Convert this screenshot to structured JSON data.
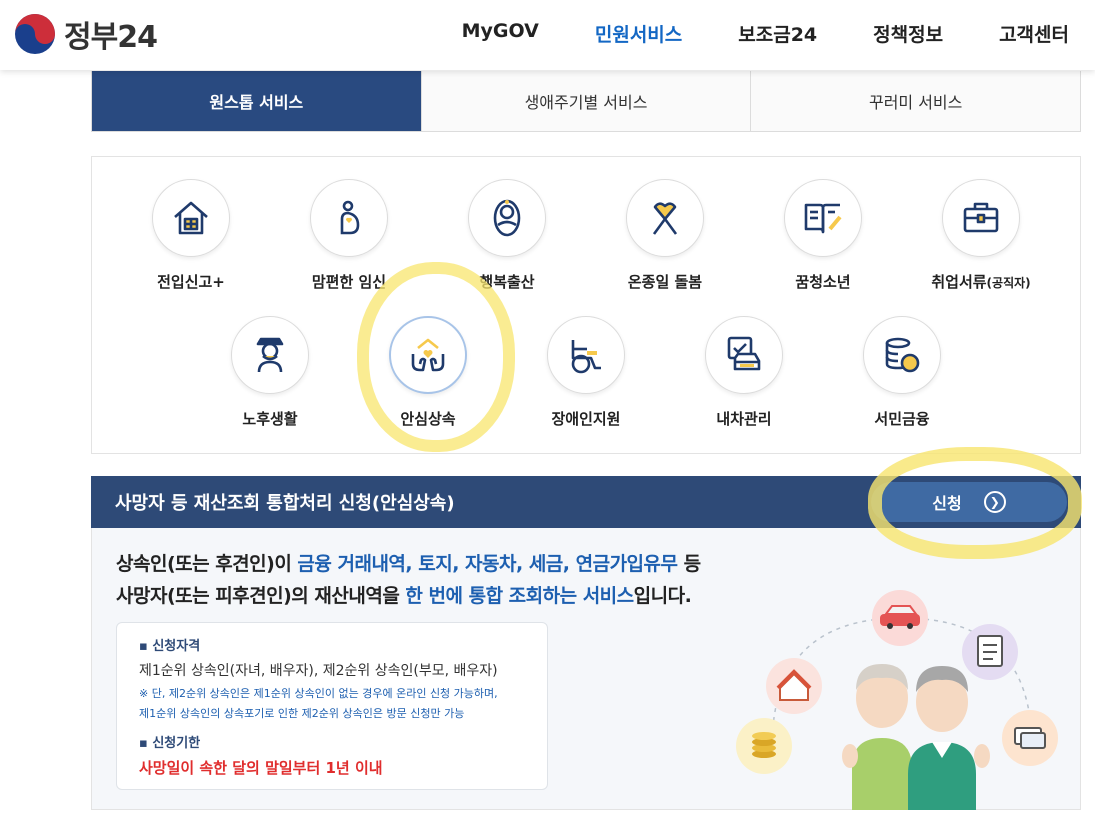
{
  "header": {
    "logo_text": "정부24",
    "nav": [
      {
        "label": "MyGOV",
        "active": false
      },
      {
        "label": "민원서비스",
        "active": true
      },
      {
        "label": "보조금24",
        "active": false
      },
      {
        "label": "정책정보",
        "active": false
      },
      {
        "label": "고객센터",
        "active": false
      }
    ]
  },
  "tabs": [
    {
      "label": "원스톱 서비스",
      "active": true
    },
    {
      "label": "생애주기별 서비스",
      "active": false
    },
    {
      "label": "꾸러미 서비스",
      "active": false
    }
  ],
  "services_row1": [
    {
      "label": "전입신고+",
      "icon": "house-icon"
    },
    {
      "label": "맘편한 임신",
      "icon": "pregnancy-icon"
    },
    {
      "label": "행복출산",
      "icon": "baby-icon"
    },
    {
      "label": "온종일 돌봄",
      "icon": "ribbon-heart-icon"
    },
    {
      "label": "꿈청소년",
      "icon": "open-book-icon"
    },
    {
      "label": "취업서류",
      "label_small": "(공직자)",
      "icon": "briefcase-icon"
    }
  ],
  "services_row2": [
    {
      "label": "노후생활",
      "icon": "elderly-icon"
    },
    {
      "label": "안심상속",
      "icon": "hands-house-heart-icon",
      "selected": true
    },
    {
      "label": "장애인지원",
      "icon": "wheelchair-icon"
    },
    {
      "label": "내차관리",
      "icon": "car-check-icon"
    },
    {
      "label": "서민금융",
      "icon": "coins-icon"
    }
  ],
  "detail": {
    "title": "사망자 등 재산조회 통합처리 신청(안심상속)",
    "apply_label": "신청",
    "headline_line1": {
      "a": "상속인(또는 후견인)이 ",
      "b": "금융 거래내역, 토지, 자동차, 세금, 연금가입유무",
      "c": " 등"
    },
    "headline_line2": {
      "a": "사망자(또는 피후견인)의 재산내역을 ",
      "b": "한 번에 통합 조회하는 서비스",
      "c": "입니다."
    },
    "eligibility_heading": "신청자격",
    "eligibility_text": "제1순위 상속인(자녀, 배우자), 제2순위 상속인(부모, 배우자)",
    "eligibility_note1": "※ 단, 제2순위 상속인은 제1순위 상속인이 없는 경우에 온라인 신청 가능하며,",
    "eligibility_note2": "제1순위 상속인의 상속포기로 인한 제2순위 상속인은 방문 신청만 가능",
    "deadline_heading": "신청기한",
    "deadline_text": "사망일이 속한 달의 말일부터 1년 이내"
  },
  "colors": {
    "brand_blue": "#294a80",
    "nav_active": "#1367c4",
    "highlight_text": "#1d5fb0",
    "deadline_red": "#e02d2d",
    "marker_yellow": "#f8e56e"
  }
}
